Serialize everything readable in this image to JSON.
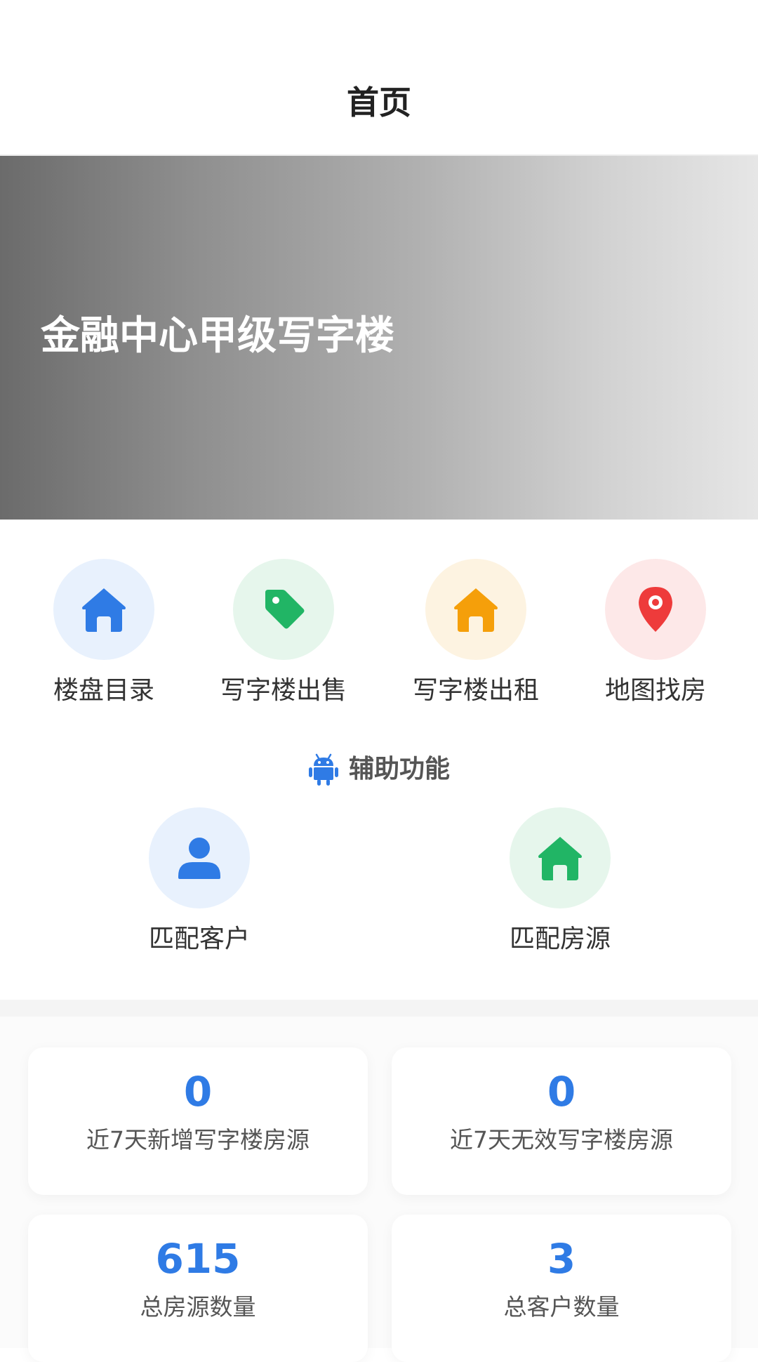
{
  "header": {
    "title": "首页"
  },
  "banner": {
    "title": "金融中心甲级写字楼",
    "slide_count": 3,
    "active_index": 0
  },
  "quick_entries": [
    {
      "label": "楼盘目录",
      "icon": "house-icon",
      "icon_color": "#2f7be5",
      "bg_color": "#e8f1fd"
    },
    {
      "label": "写字楼出售",
      "icon": "tag-icon",
      "icon_color": "#21b565",
      "bg_color": "#e6f6ec"
    },
    {
      "label": "写字楼出租",
      "icon": "house-icon",
      "icon_color": "#f59f0a",
      "bg_color": "#fdf3e1"
    },
    {
      "label": "地图找房",
      "icon": "map-pin-icon",
      "icon_color": "#ee3b3b",
      "bg_color": "#fde8e8"
    }
  ],
  "aux_section": {
    "title": "辅助功能",
    "icon": "android-icon",
    "icon_color": "#2f7be5",
    "items": [
      {
        "label": "匹配客户",
        "icon": "user-icon",
        "icon_color": "#2f7be5",
        "bg_color": "#e8f1fd"
      },
      {
        "label": "匹配房源",
        "icon": "house-icon",
        "icon_color": "#21b565",
        "bg_color": "#e6f6ec"
      }
    ]
  },
  "stats": [
    {
      "value": "0",
      "label": "近7天新增写字楼房源"
    },
    {
      "value": "0",
      "label": "近7天无效写字楼房源"
    },
    {
      "value": "615",
      "label": "总房源数量"
    },
    {
      "value": "3",
      "label": "总客户数量"
    }
  ],
  "colors": {
    "accent": "#2f7be5",
    "green": "#21b565",
    "orange": "#f59f0a",
    "red": "#ee3b3b"
  }
}
